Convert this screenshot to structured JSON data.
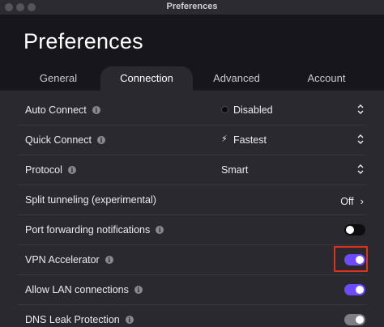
{
  "window": {
    "title": "Preferences"
  },
  "header": {
    "title": "Preferences"
  },
  "tabs": [
    {
      "label": "General"
    },
    {
      "label": "Connection"
    },
    {
      "label": "Advanced"
    },
    {
      "label": "Account"
    }
  ],
  "active_tab": "Connection",
  "rows": [
    {
      "label": "Auto Connect",
      "info": "i",
      "control": "select",
      "value": "Disabled",
      "prefix_icon": "dot-icon"
    },
    {
      "label": "Quick Connect",
      "info": "i",
      "control": "select",
      "value": "Fastest",
      "prefix_icon": "bolt-icon"
    },
    {
      "label": "Protocol",
      "info": "i",
      "control": "select",
      "value": "Smart"
    },
    {
      "label": "Split tunneling (experimental)",
      "control": "link",
      "value": "Off"
    },
    {
      "label": "Port forwarding notifications",
      "info": "i",
      "control": "toggle",
      "state": "off"
    },
    {
      "label": "VPN Accelerator",
      "info": "i",
      "control": "toggle",
      "state": "on",
      "highlighted": true
    },
    {
      "label": "Allow LAN connections",
      "info": "i",
      "control": "toggle",
      "state": "on"
    },
    {
      "label": "DNS Leak Protection",
      "info": "i",
      "control": "toggle",
      "state": "on-disabled"
    }
  ],
  "colors": {
    "accent": "#6d4aff",
    "highlight_box": "#e0301e",
    "background": "#2a2930",
    "header": "#17161c"
  }
}
